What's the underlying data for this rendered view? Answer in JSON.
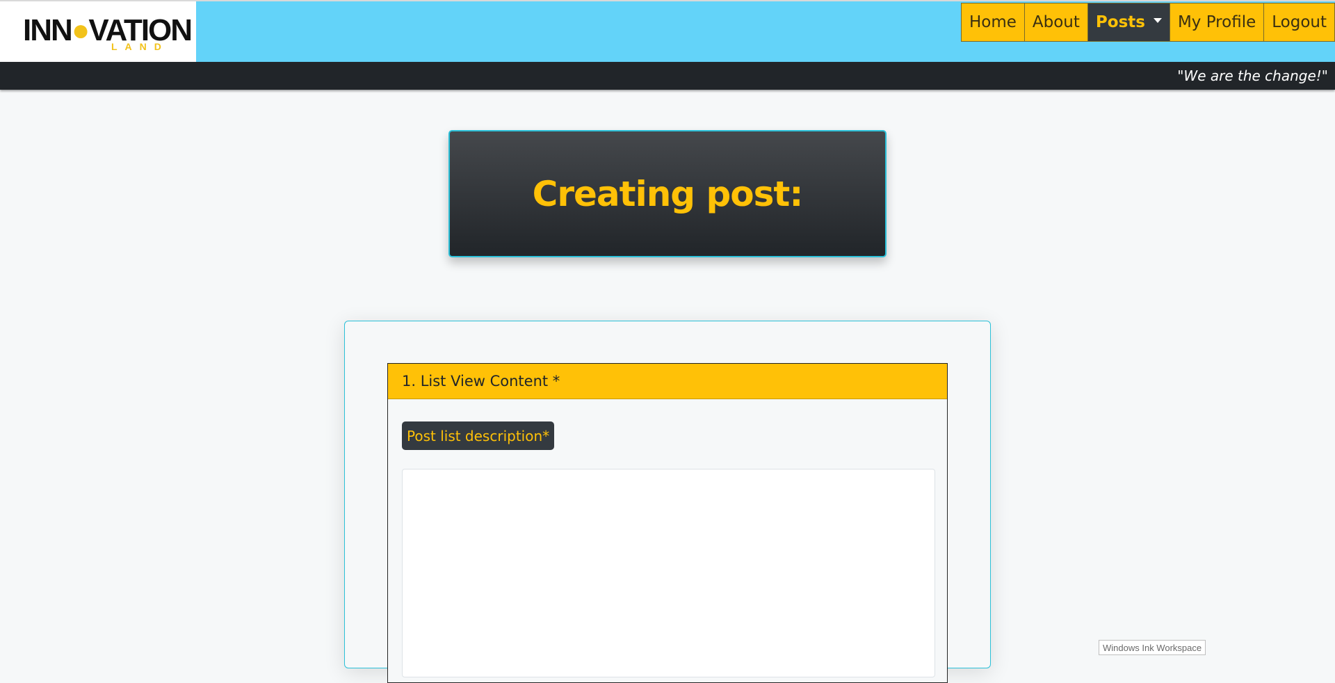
{
  "logo": {
    "name_prefix": "INN",
    "name_suffix": "VATION",
    "sub": "LAND"
  },
  "nav": {
    "items": [
      {
        "label": "Home"
      },
      {
        "label": "About"
      },
      {
        "label": "Posts",
        "active": true,
        "dropdown": true
      },
      {
        "label": "My Profile"
      },
      {
        "label": "Logout"
      }
    ]
  },
  "slogan": "\"We are the change!\"",
  "page": {
    "title": "Creating post:"
  },
  "form": {
    "section_title": "1. List View Content *",
    "field_label": "Post list description*",
    "field_value": ""
  },
  "overlay": {
    "ink_workspace": "Windows Ink Workspace"
  },
  "colors": {
    "navbar_bg": "#63d3f9",
    "accent": "#ffc107",
    "dark": "#212529",
    "border_teal": "#2bc0d8"
  }
}
